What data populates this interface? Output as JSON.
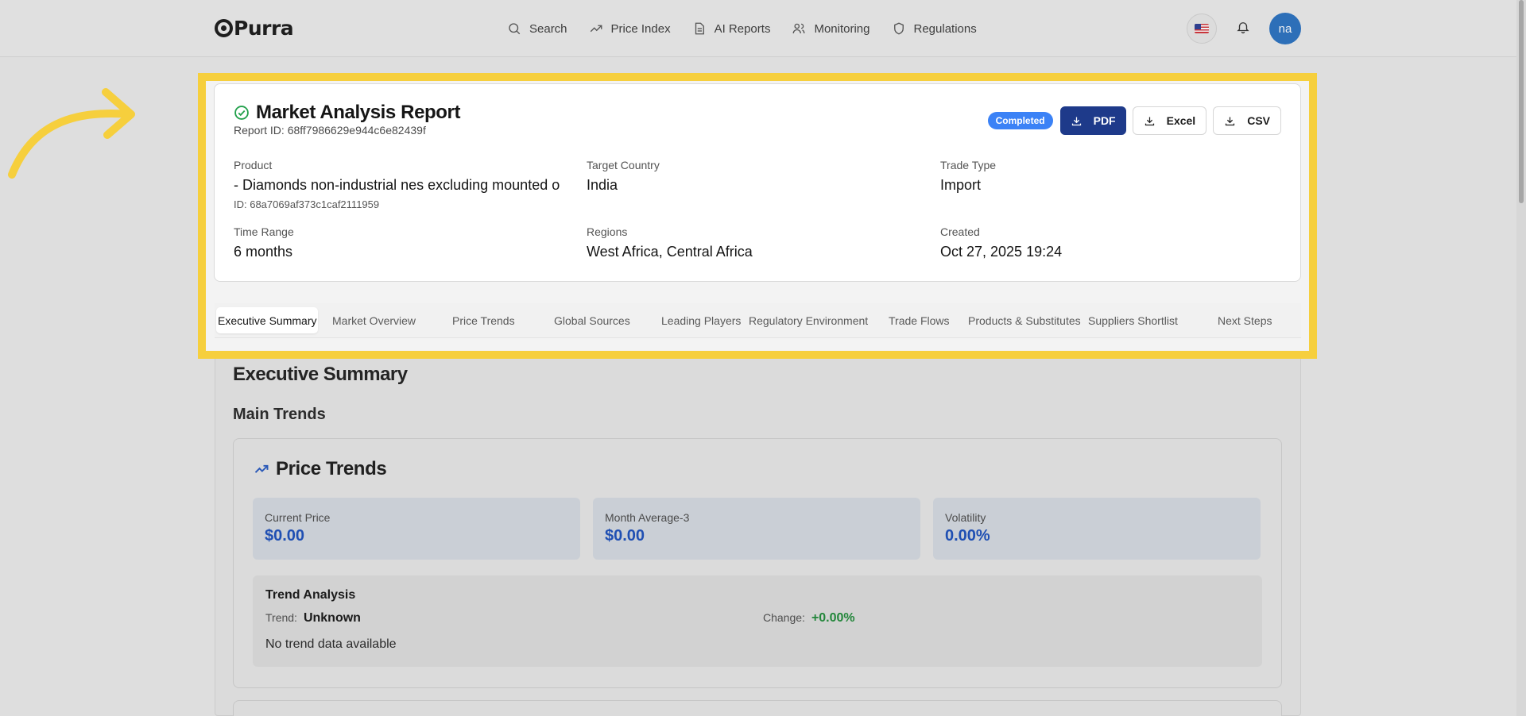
{
  "header": {
    "logo": "Purra",
    "nav": [
      {
        "label": "Search",
        "icon": "search-icon"
      },
      {
        "label": "Price Index",
        "icon": "trending-up-icon"
      },
      {
        "label": "AI Reports",
        "icon": "document-icon"
      },
      {
        "label": "Monitoring",
        "icon": "users-icon"
      },
      {
        "label": "Regulations",
        "icon": "shield-icon"
      }
    ],
    "avatar_initials": "na"
  },
  "report": {
    "title": "Market Analysis Report",
    "report_id": "Report ID: 68ff7986629e944c6e82439f",
    "status": "Completed",
    "export_buttons": {
      "pdf": "PDF",
      "excel": "Excel",
      "csv": "CSV"
    },
    "fields": {
      "product_label": "Product",
      "product_value": "- Diamonds non-industrial nes excluding mounted o",
      "product_id": "ID: 68a7069af373c1caf2111959",
      "country_label": "Target Country",
      "country_value": "India",
      "trade_label": "Trade Type",
      "trade_value": "Import",
      "time_label": "Time Range",
      "time_value": "6 months",
      "regions_label": "Regions",
      "regions_value": "West Africa, Central Africa",
      "created_label": "Created",
      "created_value": "Oct 27, 2025 19:24"
    }
  },
  "tabs": [
    "Executive Summary",
    "Market Overview",
    "Price Trends",
    "Global Sources",
    "Leading Players",
    "Regulatory Environment",
    "Trade Flows",
    "Products & Substitutes",
    "Suppliers Shortlist",
    "Next Steps"
  ],
  "summary": {
    "title": "Executive Summary",
    "main_trends": "Main Trends",
    "price_trends": {
      "title": "Price Trends",
      "metrics": [
        {
          "label": "Current Price",
          "value": "$0.00"
        },
        {
          "label": "Month Average-3",
          "value": "$0.00"
        },
        {
          "label": "Volatility",
          "value": "0.00%"
        }
      ],
      "trend_analysis": {
        "title": "Trend Analysis",
        "trend_label": "Trend:",
        "trend_value": "Unknown",
        "change_label": "Change:",
        "change_value": "+0.00%",
        "note": "No trend data available"
      }
    }
  },
  "colors": {
    "highlight": "#f6cf3d",
    "primary": "#1e3a8a",
    "badge": "#3b82f6",
    "accent_blue": "#1f4fb3",
    "positive": "#22863a"
  }
}
